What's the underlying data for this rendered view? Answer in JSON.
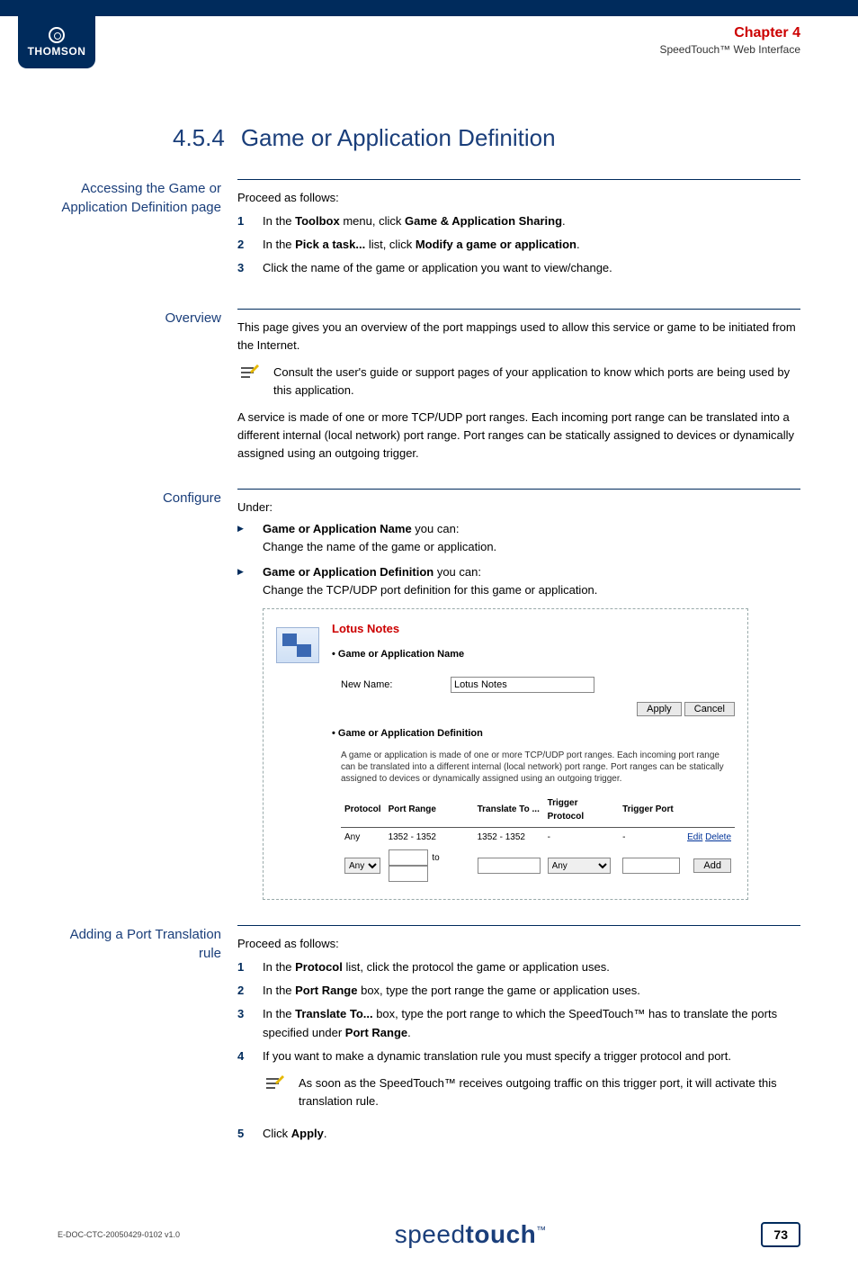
{
  "logo": {
    "brand": "THOMSON"
  },
  "header": {
    "chapter": "Chapter 4",
    "subtitle": "SpeedTouch™ Web Interface"
  },
  "title": {
    "num": "4.5.4",
    "text": "Game or Application Definition"
  },
  "s1": {
    "label": "Accessing the Game or Application Definition page",
    "intro": "Proceed as follows:",
    "i1a": "In the ",
    "i1b": "Toolbox",
    "i1c": " menu, click ",
    "i1d": "Game & Application Sharing",
    "i1e": ".",
    "i2a": "In the ",
    "i2b": "Pick a task...",
    "i2c": " list, click ",
    "i2d": "Modify a game or application",
    "i2e": ".",
    "i3": "Click the name of the game or application you want to view/change."
  },
  "s2": {
    "label": "Overview",
    "p1": "This page gives you an overview of the port mappings used to allow this service or game to be initiated from the Internet.",
    "note": "Consult the user's guide or support pages of your application to know which ports are being used by this application.",
    "p2": "A service is made of one or more TCP/UDP port ranges. Each incoming port range can be translated into a different internal (local network) port range. Port ranges can be statically assigned to devices or dynamically assigned using an outgoing trigger."
  },
  "s3": {
    "label": "Configure",
    "intro": "Under:",
    "li1a": "Game or Application Name",
    "li1b": " you can:",
    "li1c": "Change the name of the game or application.",
    "li2a": "Game or Application Definition",
    "li2b": " you can:",
    "li2c": "Change the TCP/UDP port definition for this game or application."
  },
  "panel": {
    "title": "Lotus Notes",
    "sec1": "Game or Application Name",
    "newname_label": "New Name:",
    "newname_value": "Lotus Notes",
    "apply": "Apply",
    "cancel": "Cancel",
    "sec2": "Game or Application Definition",
    "desc": "A game or application is made of one or more TCP/UDP port ranges. Each incoming port range can be translated into a different internal (local network) port range. Port ranges can be statically assigned to devices or dynamically assigned using an outgoing trigger.",
    "th": {
      "protocol": "Protocol",
      "portrange": "Port Range",
      "translate": "Translate To ...",
      "trigproto": "Trigger Protocol",
      "trigport": "Trigger Port"
    },
    "row": {
      "protocol": "Any",
      "portrange": "1352 - 1352",
      "translate": "1352 - 1352",
      "trigproto": "-",
      "trigport": "-",
      "edit": "Edit",
      "delete": "Delete"
    },
    "form": {
      "proto_sel": "Any",
      "to": "to",
      "trig_sel": "Any",
      "add": "Add"
    }
  },
  "s4": {
    "label": "Adding a Port Translation rule",
    "intro": "Proceed as follows:",
    "i1a": "In the ",
    "i1b": "Protocol",
    "i1c": " list, click the protocol the game or application uses.",
    "i2a": "In the ",
    "i2b": "Port Range",
    "i2c": " box, type the port range the game or application uses.",
    "i3a": "In the ",
    "i3b": "Translate To...",
    "i3c": " box, type the port range to which the SpeedTouch™ has to translate the ports specified under ",
    "i3d": "Port Range",
    "i3e": ".",
    "i4": "If you want to make a dynamic translation rule you must specify a trigger protocol and port.",
    "note": "As soon as the SpeedTouch™ receives outgoing traffic on this trigger port, it will activate this translation rule.",
    "i5a": "Click ",
    "i5b": "Apply",
    "i5c": "."
  },
  "footer": {
    "docid": "E-DOC-CTC-20050429-0102 v1.0",
    "brand_light": "speed",
    "brand_bold": "touch",
    "tm": "™",
    "page": "73"
  }
}
